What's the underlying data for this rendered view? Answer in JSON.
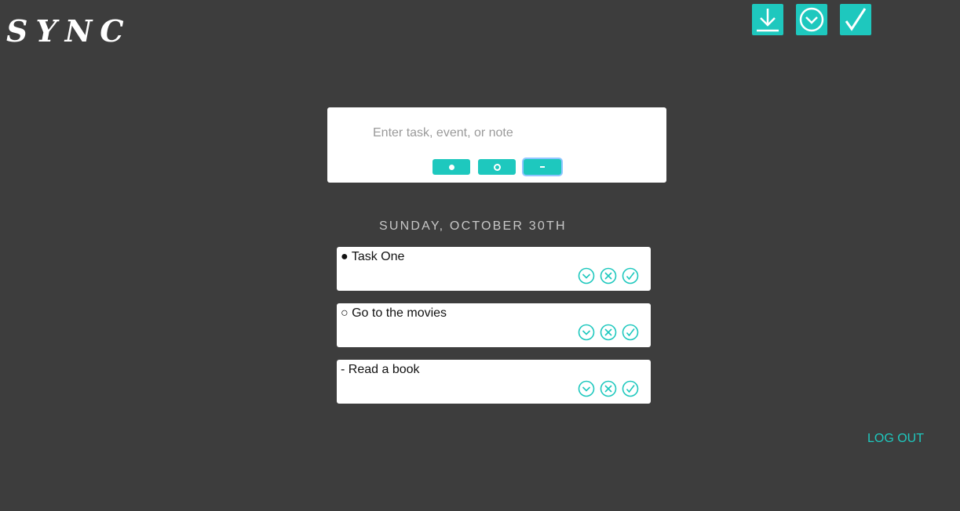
{
  "app": {
    "logo": "SYNC"
  },
  "toolbar": {
    "icons": [
      "download-icon",
      "chevron-circle-icon",
      "check-icon"
    ]
  },
  "entry": {
    "placeholder": "Enter task, event, or note",
    "value": "",
    "types": [
      {
        "symbol": "task-bullet-filled"
      },
      {
        "symbol": "event-bullet-hollow"
      },
      {
        "symbol": "note-dash",
        "selected": true
      }
    ]
  },
  "date_heading": "SUNDAY, OCTOBER 30TH",
  "entries": [
    {
      "text": "● Task One"
    },
    {
      "text": "○ Go to the movies"
    },
    {
      "text": "- Read a book"
    }
  ],
  "logout_label": "LOG OUT",
  "colors": {
    "background": "#3d3d3d",
    "accent": "#1ec8be",
    "card": "#ffffff",
    "date_text": "#c8c8c8"
  }
}
